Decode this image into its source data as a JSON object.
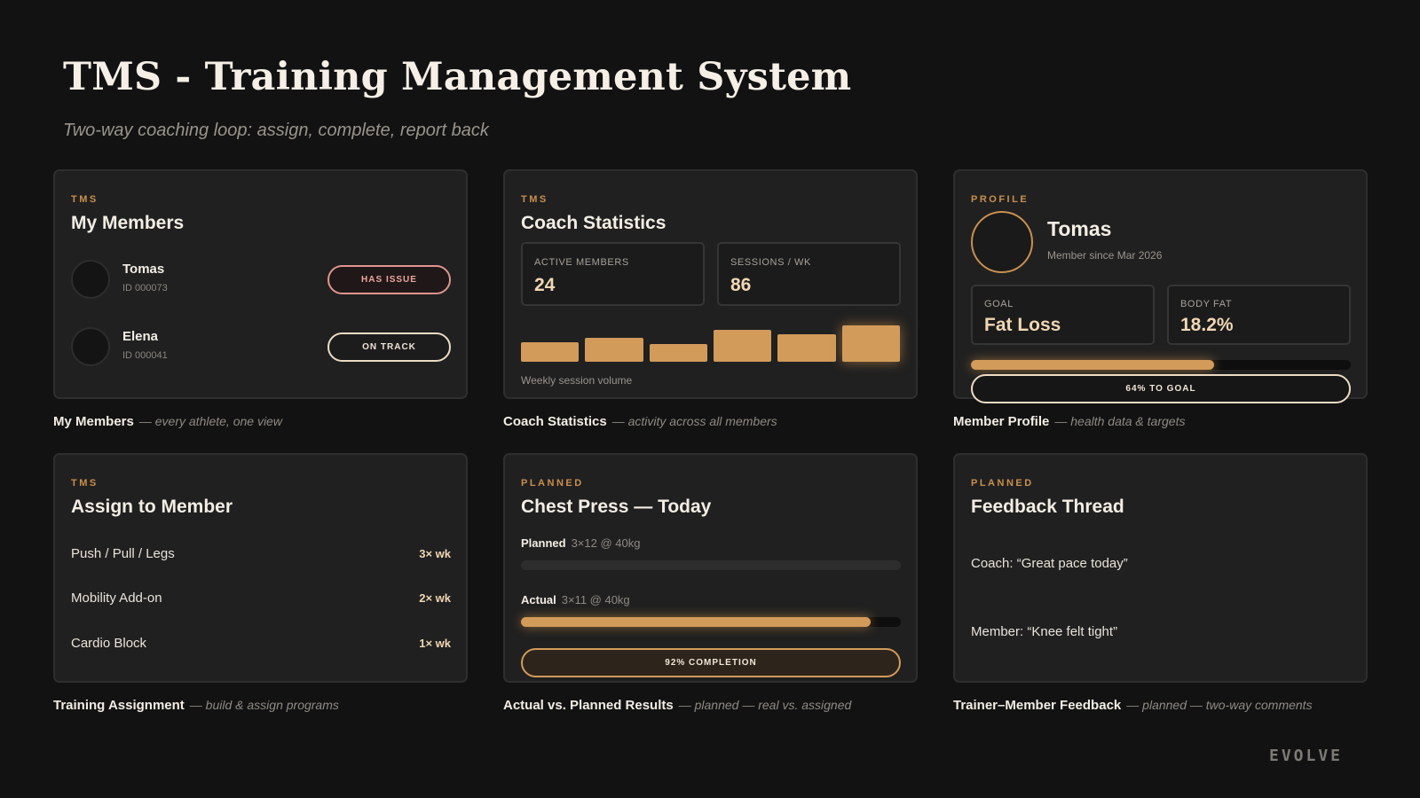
{
  "header": {
    "title": "TMS - Training Management System",
    "subtitle": "Two-way coaching loop: assign, complete, report back"
  },
  "cards": {
    "members": {
      "eyebrow": "TMS",
      "title": "My Members",
      "items": [
        {
          "name": "Tomas",
          "id": "ID 000073",
          "status": "HAS ISSUE"
        },
        {
          "name": "Elena",
          "id": "ID 000041",
          "status": "ON TRACK"
        }
      ],
      "caption_title": "My Members",
      "caption_note": "— every athlete, one view"
    },
    "stats": {
      "eyebrow": "TMS",
      "title": "Coach Statistics",
      "active_label": "ACTIVE MEMBERS",
      "active_value": "24",
      "sessions_label": "SESSIONS / WK",
      "sessions_value": "86",
      "chart_note": "Weekly session volume",
      "caption_title": "Coach Statistics",
      "caption_note": "— activity across all members"
    },
    "profile": {
      "eyebrow": "PROFILE",
      "name": "Tomas",
      "since": "Member since Mar 2026",
      "goal_label": "GOAL",
      "goal_value": "Fat Loss",
      "bodyfat_label": "BODY FAT",
      "bodyfat_value": "18.2%",
      "goal_progress": 0.64,
      "goal_progress_label": "64% TO GOAL",
      "caption_title": "Member Profile",
      "caption_note": "— health data & targets"
    },
    "assign": {
      "eyebrow": "TMS",
      "title": "Assign to Member",
      "items": [
        {
          "label": "Push / Pull / Legs",
          "freq": "3× wk"
        },
        {
          "label": "Mobility Add-on",
          "freq": "2× wk"
        },
        {
          "label": "Cardio Block",
          "freq": "1× wk"
        }
      ],
      "caption_title": "Training Assignment",
      "caption_note": "— build & assign programs"
    },
    "chest": {
      "eyebrow": "PLANNED",
      "title": "Chest Press — Today",
      "planned_label": "Planned",
      "planned_value": "3×12 @ 40kg",
      "actual_label": "Actual",
      "actual_value": "3×11 @ 40kg",
      "actual_progress": 0.92,
      "completion_label": "92% COMPLETION",
      "caption_title": "Actual vs. Planned Results",
      "caption_note": "— planned — real vs. assigned"
    },
    "feedback": {
      "eyebrow": "PLANNED",
      "title": "Feedback Thread",
      "coach": "Coach: “Great pace today”",
      "member": "Member: “Knee felt tight”",
      "caption_title": "Trainer–Member Feedback",
      "caption_note": "— planned — two-way comments"
    }
  },
  "chart_data": {
    "type": "bar",
    "categories": [
      "1",
      "2",
      "3",
      "4",
      "5",
      "6"
    ],
    "values": [
      22,
      27,
      20,
      36,
      31,
      41
    ],
    "title": "",
    "xlabel": "Weekly session volume",
    "ylabel": "",
    "ylim": [
      0,
      45
    ]
  },
  "brand": {
    "logo": "EVOLVE",
    "accent": "#d29b5a",
    "background": "#121212",
    "card": "#202020"
  }
}
